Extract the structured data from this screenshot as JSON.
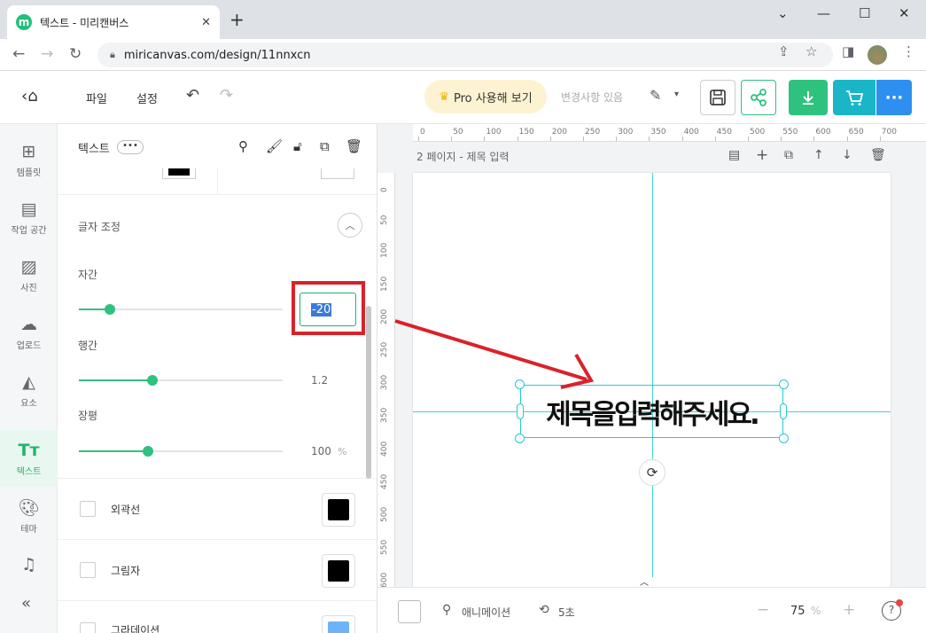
{
  "browser": {
    "tab_title": "텍스트 - 미리캔버스",
    "tab_favicon_letter": "m",
    "url": "miricanvas.com/design/11nnxcn",
    "icons": [
      "back-arrow-icon",
      "forward-arrow-icon",
      "reload-icon",
      "lock-icon",
      "share-icon",
      "star-icon",
      "sidebar-icon",
      "profile-avatar",
      "kebab-icon"
    ]
  },
  "header": {
    "menu_file": "파일",
    "menu_settings": "설정",
    "pro_button": "Pro 사용해 보기",
    "save_status": "변경사항 있음",
    "colors": {
      "share_green": "#2ec27e",
      "cart_teal": "#1ab6c7",
      "more_blue": "#2d8ff0",
      "pro_bg": "#fdf3d2"
    }
  },
  "rail": {
    "items": [
      {
        "label": "템플릿",
        "icon": "layout-icon"
      },
      {
        "label": "작업 공간",
        "icon": "archive-icon"
      },
      {
        "label": "사진",
        "icon": "photo-icon"
      },
      {
        "label": "업로드",
        "icon": "upload-cloud-icon"
      },
      {
        "label": "요소",
        "icon": "shapes-icon"
      },
      {
        "label": "텍스트",
        "icon": "text-icon",
        "active": true
      },
      {
        "label": "테마",
        "icon": "palette-icon"
      },
      {
        "label": "",
        "icon": "music-icon"
      }
    ],
    "active_color": "#21b36c"
  },
  "panel": {
    "title": "텍스트",
    "section_title": "글자 조정",
    "letter_spacing": {
      "label": "자간",
      "value": "-20",
      "slider_fraction": 0.15
    },
    "line_height": {
      "label": "행간",
      "value": "1.2",
      "slider_fraction": 0.36
    },
    "width_scale": {
      "label": "장평",
      "value": "100",
      "unit": "%",
      "slider_fraction": 0.34
    },
    "outline": {
      "label": "외곽선",
      "color": "#000000"
    },
    "shadow": {
      "label": "그림자",
      "color": "#000000"
    },
    "gradient": {
      "label": "그라데이션",
      "color": "#6cb4f7"
    }
  },
  "canvas": {
    "page_label": "2 페이지 - 제목 입력",
    "ruler_top": [
      "0",
      "50",
      "100",
      "150",
      "200",
      "250",
      "300",
      "350",
      "400",
      "450",
      "500",
      "550",
      "600",
      "650",
      "700"
    ],
    "ruler_left": [
      "0",
      "50",
      "100",
      "150",
      "200",
      "250",
      "300",
      "350",
      "400",
      "450",
      "500",
      "550",
      "600"
    ],
    "text_content": "제목을입력해주세요.",
    "guide_color": "#3fd6d6"
  },
  "bottombar": {
    "animation_label": "애니메이션",
    "duration_label": "5초",
    "zoom_value": "75",
    "zoom_unit": "%"
  }
}
